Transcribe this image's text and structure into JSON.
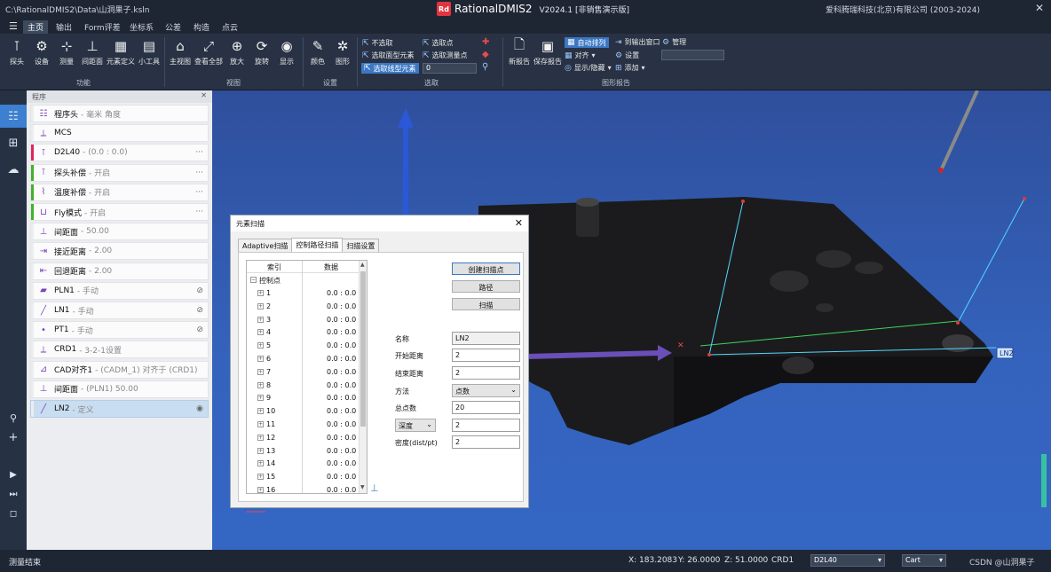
{
  "titlebar": {
    "path": "C:\\RationalDMIS2\\Data\\山洞果子.ksln",
    "logo": "Rd",
    "app_name": "RationalDMIS2",
    "version": "V2024.1 [非销售演示版]",
    "copyright": "爱科腾瑞科技(北京)有限公司 (2003-2024)"
  },
  "menubar": {
    "tabs": [
      "主页",
      "输出",
      "Form评差",
      "坐标系",
      "公差",
      "构造",
      "点云"
    ]
  },
  "ribbon": {
    "function_buttons": [
      {
        "label": "探头",
        "icon": "probe-icon"
      },
      {
        "label": "设备",
        "icon": "device-icon"
      },
      {
        "label": "测量",
        "icon": "measure-icon"
      },
      {
        "label": "间距面",
        "icon": "clearance-icon"
      },
      {
        "label": "元素定义",
        "icon": "define-element-icon"
      },
      {
        "label": "小工具",
        "icon": "toolbox-icon"
      }
    ],
    "function_group": "功能",
    "view_buttons": [
      {
        "label": "主视图",
        "icon": "home-view-icon"
      },
      {
        "label": "查看全部",
        "icon": "zoom-all-icon"
      },
      {
        "label": "放大",
        "icon": "zoom-in-icon"
      },
      {
        "label": "旋转",
        "icon": "rotate-icon"
      },
      {
        "label": "显示",
        "icon": "eye-icon"
      }
    ],
    "view_group": "视图",
    "settings_buttons": [
      {
        "label": "颜色",
        "icon": "color-icon"
      },
      {
        "label": "图形",
        "icon": "graphics-icon"
      }
    ],
    "settings_group": "设置",
    "select": {
      "deselect": "不选取",
      "select_point": "选取点",
      "select_surface": "选取面型元素",
      "select_measured_point": "选取测量点",
      "select_line": "选取线型元素",
      "count_value": "0",
      "group": "选取"
    },
    "report_buttons": [
      {
        "label": "新报告",
        "icon": "new-report-icon"
      },
      {
        "label": "保存报告",
        "icon": "save-report-icon"
      }
    ],
    "report_options": {
      "auto_arrange": "自动排列",
      "align": "对齐",
      "show_hide": "显示/隐藏",
      "to_output": "到输出窗口",
      "settings": "设置",
      "add": "添加",
      "manage": "管理",
      "group": "图形报告"
    }
  },
  "program": {
    "header": "程序",
    "items": [
      {
        "label": "程序头",
        "sub": "- 毫米 角度",
        "icon": "list-icon",
        "bar": "#ebedf0"
      },
      {
        "label": "MCS",
        "sub": "",
        "icon": "axis-icon",
        "bar": "#ebedf0"
      },
      {
        "label": "D2L40",
        "sub": "- (0.0 : 0.0)",
        "icon": "probe-icon",
        "bar": "#e0245e"
      },
      {
        "label": "探头补偿",
        "sub": "- 开启",
        "icon": "probe-comp-icon",
        "bar": "#43b02a"
      },
      {
        "label": "温度补偿",
        "sub": "- 开启",
        "icon": "temperature-icon",
        "bar": "#43b02a"
      },
      {
        "label": "Fly模式",
        "sub": "- 开启",
        "icon": "fly-mode-icon",
        "bar": "#43b02a"
      },
      {
        "label": "间距面",
        "sub": "- 50.00",
        "icon": "clearance-icon",
        "bar": "#ebedf0"
      },
      {
        "label": "接近距离",
        "sub": "- 2.00",
        "icon": "approach-icon",
        "bar": "#ebedf0"
      },
      {
        "label": "回退距离",
        "sub": "- 2.00",
        "icon": "retract-icon",
        "bar": "#ebedf0"
      },
      {
        "label": "PLN1",
        "sub": "- 手动",
        "icon": "plane-icon",
        "bar": "#ebedf0"
      },
      {
        "label": "LN1",
        "sub": "- 手动",
        "icon": "line-icon",
        "bar": "#ebedf0"
      },
      {
        "label": "PT1",
        "sub": "- 手动",
        "icon": "point-icon",
        "bar": "#ebedf0"
      },
      {
        "label": "CRD1",
        "sub": "- 3-2-1设置",
        "icon": "coordinate-icon",
        "bar": "#ebedf0"
      },
      {
        "label": "CAD对齐1",
        "sub": "- (CADM_1) 对齐于 (CRD1)",
        "icon": "cad-align-icon",
        "bar": "#ebedf0"
      },
      {
        "label": "间距面",
        "sub": "- (PLN1) 50.00",
        "icon": "clearance-icon",
        "bar": "#ebedf0"
      },
      {
        "label": "LN2",
        "sub": "- 定义",
        "icon": "line-icon",
        "bar": "#ebedf0"
      }
    ]
  },
  "viewport": {
    "label_ln2": "LN2"
  },
  "dialog": {
    "title": "元素扫描",
    "tabs": [
      "Adaptive扫描",
      "控制路径扫描",
      "扫描设置"
    ],
    "tree": {
      "col_index": "索引",
      "col_data": "数据",
      "root": "控制点",
      "rows": [
        {
          "idx": "1",
          "val": "0.0 : 0.0"
        },
        {
          "idx": "2",
          "val": "0.0 : 0.0"
        },
        {
          "idx": "3",
          "val": "0.0 : 0.0"
        },
        {
          "idx": "4",
          "val": "0.0 : 0.0"
        },
        {
          "idx": "5",
          "val": "0.0 : 0.0"
        },
        {
          "idx": "6",
          "val": "0.0 : 0.0"
        },
        {
          "idx": "7",
          "val": "0.0 : 0.0"
        },
        {
          "idx": "8",
          "val": "0.0 : 0.0"
        },
        {
          "idx": "9",
          "val": "0.0 : 0.0"
        },
        {
          "idx": "10",
          "val": "0.0 : 0.0"
        },
        {
          "idx": "11",
          "val": "0.0 : 0.0"
        },
        {
          "idx": "12",
          "val": "0.0 : 0.0"
        },
        {
          "idx": "13",
          "val": "0.0 : 0.0"
        },
        {
          "idx": "14",
          "val": "0.0 : 0.0"
        },
        {
          "idx": "15",
          "val": "0.0 : 0.0"
        },
        {
          "idx": "16",
          "val": "0.0 : 0.0"
        }
      ]
    },
    "buttons": {
      "create_points": "创建扫描点",
      "path": "路径",
      "scan": "扫描"
    },
    "fields": {
      "name_label": "名称",
      "name_value": "LN2",
      "start_label": "开始距离",
      "start_value": "2",
      "end_label": "结束距离",
      "end_value": "2",
      "method_label": "方法",
      "method_value": "点数",
      "total_label": "总点数",
      "total_value": "20",
      "depth_select": "深度",
      "depth_value": "2",
      "density_label": "密度(dist/pt)",
      "density_value": "2"
    }
  },
  "statusbar": {
    "message": "测量结束",
    "x": "X: 183.2083",
    "y": "Y: 26.0000",
    "z": "Z: 51.0000",
    "crd": "CRD1",
    "probe": "D2L40",
    "coord_mode": "Cart",
    "watermark": "CSDN @山洞果子"
  }
}
